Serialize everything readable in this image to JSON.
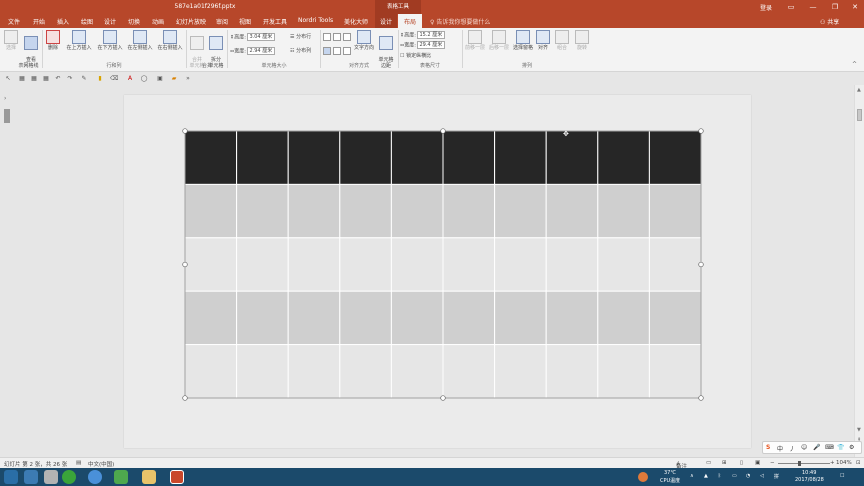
{
  "window": {
    "title": "587e1a01f296f.pptx",
    "context_tools": "表格工具",
    "login": "登录",
    "share": "共享",
    "controls": [
      "▭",
      "—",
      "❐",
      "✕"
    ]
  },
  "tabs": [
    "文件",
    "开始",
    "插入",
    "绘图",
    "设计",
    "切换",
    "动画",
    "幻灯片放映",
    "审阅",
    "视图",
    "开发工具",
    "Nordri Tools",
    "美化大师",
    "设计",
    "布局"
  ],
  "tell_me": "告诉我你想要做什么",
  "ribbon": {
    "buttons": {
      "select": "选择",
      "gridlines": "查看\n网格线",
      "delete": "删除",
      "insert_above": "在上方插入",
      "insert_below": "在下方插入",
      "insert_left": "在左侧插入",
      "insert_right": "在右侧插入",
      "merge": "合并\n单元格",
      "split": "拆分\n单元格",
      "dist_rows": "分布行",
      "dist_cols": "分布列",
      "text_direction": "文字方向",
      "cell_margins": "单元格\n边距",
      "bring_forward": "前移一层",
      "send_backward": "后移一层",
      "selection_pane": "选择窗格",
      "align": "对齐",
      "group": "组合",
      "rotate": "旋转"
    },
    "cell_size": {
      "height_label": "高度:",
      "height_value": "3.04 厘米",
      "width_label": "宽度:",
      "width_value": "2.94 厘米"
    },
    "table_size": {
      "height_label": "高度:",
      "height_value": "15.2 厘米",
      "width_label": "宽度:",
      "width_value": "29.4 厘米",
      "lock_ratio": "锁定纵横比"
    },
    "groups": [
      "表",
      "行和列",
      "合并",
      "单元格大小",
      "对齐方式",
      "表格尺寸",
      "排列"
    ]
  },
  "table": {
    "rows": 5,
    "cols": 10,
    "row_colors": [
      "#262626",
      "#cfcfcf",
      "#e6e6e6",
      "#cfcfcf",
      "#e6e6e6"
    ]
  },
  "status": {
    "slide_info": "幻灯片 第 2 张，共 26 张",
    "language": "中文(中国)",
    "notes": "备注",
    "zoom": "104%"
  },
  "ime": [
    "中",
    "丿",
    "☺",
    "🎤",
    "⌨",
    "👕",
    "⚙"
  ],
  "taskbar": {
    "temp": "37℃",
    "cpu": "CPU温度",
    "time": "10:49",
    "date": "2017/08/28"
  },
  "colors": {
    "accent": "#b7472a",
    "context": "#a13b22"
  }
}
